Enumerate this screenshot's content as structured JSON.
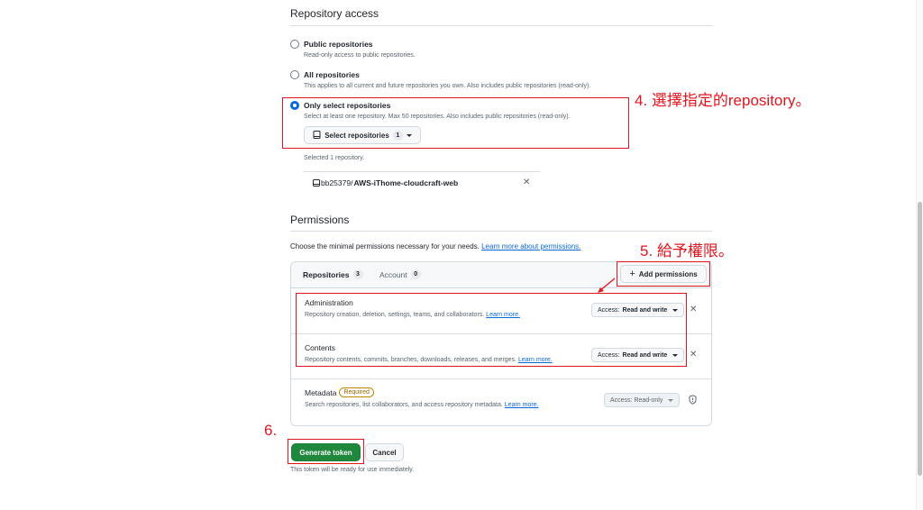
{
  "repo_access": {
    "heading": "Repository access",
    "options": [
      {
        "title": "Public repositories",
        "desc": "Read-only access to public repositories."
      },
      {
        "title": "All repositories",
        "desc": "This applies to all current and future repositories you own. Also includes public repositories (read-only)."
      },
      {
        "title": "Only select repositories",
        "desc": "Select at least one repository. Max 50 repositories. Also includes public repositories (read-only)."
      }
    ],
    "select_button_label": "Select repositories",
    "select_count": "1",
    "selected_text": "Selected 1 repository.",
    "selected_repo": {
      "owner": "bb25379/",
      "name": "AWS-iThome-cloudcraft-web"
    }
  },
  "permissions": {
    "heading": "Permissions",
    "intro": "Choose the minimal permissions necessary for your needs.",
    "intro_link": "Learn more about permissions.",
    "tabs": [
      {
        "label": "Repositories",
        "count": "3"
      },
      {
        "label": "Account",
        "count": "0"
      }
    ],
    "add_button": "Add permissions",
    "items": [
      {
        "title": "Administration",
        "desc": "Repository creation, deletion, settings, teams, and collaborators.",
        "link": "Learn more.",
        "access_prefix": "Access:",
        "access_value": "Read and write"
      },
      {
        "title": "Contents",
        "desc": "Repository contents, commits, branches, downloads, releases, and merges.",
        "link": "Learn more.",
        "access_prefix": "Access:",
        "access_value": "Read and write"
      },
      {
        "title": "Metadata",
        "badge": "Required",
        "desc": "Search repositories, list collaborators, and access repository metadata.",
        "link": "Learn more.",
        "access_label": "Access: Read-only"
      }
    ]
  },
  "footer": {
    "generate_button": "Generate token",
    "cancel_button": "Cancel",
    "note": "This token will be ready for use immediately."
  },
  "annotations": {
    "step4": "4. 選擇指定的repository。",
    "step5": "5. 給予權限。",
    "step6": "6."
  },
  "colors": {
    "accent_blue": "#0969da",
    "primary_green": "#1f883d",
    "annotation_red": "#e0161e",
    "required_orange": "#9a6700"
  }
}
